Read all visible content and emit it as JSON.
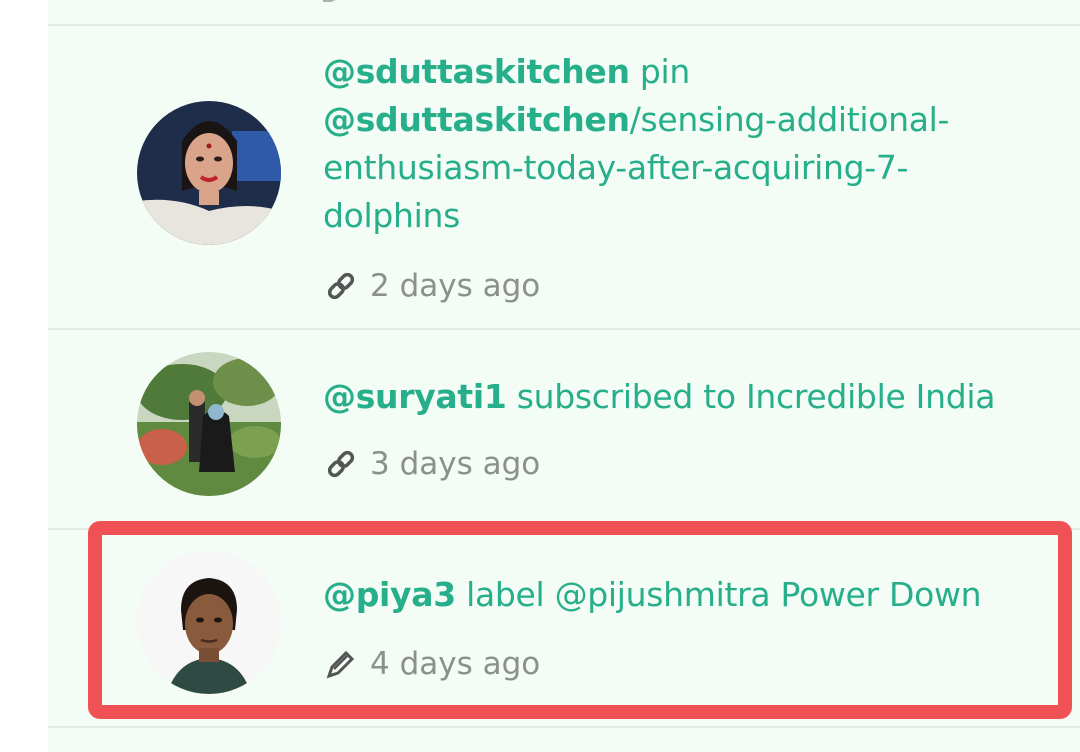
{
  "feed": [
    {
      "user": "@sduttaskitchen",
      "action": "pin",
      "link_user": "@sduttaskitchen",
      "link_line1": "/sensing-additional-",
      "link_line2": "enthusiasm-today-after-acquiring-7-",
      "link_line3": "dolphins",
      "time": "2 days ago",
      "icon": "link-icon"
    },
    {
      "user": "@suryati1",
      "action": "subscribed to Incredible India",
      "time": "3 days ago",
      "icon": "link-icon"
    },
    {
      "user": "@piya3",
      "action": "label @pijushmitra Power Down",
      "time": "4 days ago",
      "icon": "pencil-icon"
    }
  ],
  "colors": {
    "accent": "#27ae8a",
    "muted": "#8d8f8d",
    "background": "#f3fcf5",
    "highlight": "#f05155"
  }
}
